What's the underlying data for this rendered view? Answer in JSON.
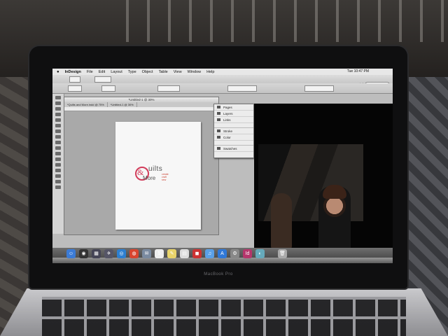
{
  "menubar": {
    "app_name": "InDesign",
    "items": [
      "File",
      "Edit",
      "Layout",
      "Type",
      "Object",
      "Table",
      "View",
      "Window",
      "Help"
    ],
    "clock": "Tue 10:47 PM",
    "battery": "100%"
  },
  "control_bar": {
    "workspace": "Essentials",
    "zoom": "30%"
  },
  "document": {
    "window_title": "*Untitled-1 @ 30%",
    "tabs": [
      "*Quilts and More.indd @ 75%",
      "*Untitled-1 @ 30%"
    ],
    "logo": {
      "amp": "&",
      "line1": "uilts",
      "line2": "More",
      "tagline": [
        "create",
        "craft",
        "sew"
      ]
    }
  },
  "panel": {
    "items": [
      "Pages",
      "Layers",
      "Links",
      "Stroke",
      "Color",
      "Swatches"
    ]
  },
  "dock": {
    "icons": [
      {
        "name": "finder-icon",
        "glyph": "☺",
        "color": "#3b7bd6"
      },
      {
        "name": "dashboard-icon",
        "glyph": "◉",
        "color": "#333"
      },
      {
        "name": "mission-control-icon",
        "glyph": "▦",
        "color": "#445"
      },
      {
        "name": "launchpad-icon",
        "glyph": "✈",
        "color": "#556"
      },
      {
        "name": "safari-icon",
        "glyph": "◎",
        "color": "#2d7fd0"
      },
      {
        "name": "chrome-icon",
        "glyph": "◍",
        "color": "#d8442f"
      },
      {
        "name": "mail-icon",
        "glyph": "✉",
        "color": "#7a8aa0"
      },
      {
        "name": "calendar-icon",
        "glyph": "5",
        "color": "#eee"
      },
      {
        "name": "notes-icon",
        "glyph": "✎",
        "color": "#e8d36a"
      },
      {
        "name": "stickies-icon",
        "glyph": "▤",
        "color": "#ddd"
      },
      {
        "name": "photo-booth-icon",
        "glyph": "◼",
        "color": "#c33"
      },
      {
        "name": "itunes-icon",
        "glyph": "♫",
        "color": "#5aa0e8"
      },
      {
        "name": "app-store-icon",
        "glyph": "A",
        "color": "#2f78d8"
      },
      {
        "name": "system-preferences-icon",
        "glyph": "⚙",
        "color": "#888"
      },
      {
        "name": "indesign-icon",
        "glyph": "Id",
        "color": "#b5366c"
      },
      {
        "name": "preview-icon",
        "glyph": "◐",
        "color": "#6ab"
      },
      {
        "name": "trash-icon",
        "glyph": "🗑",
        "color": "#aaa"
      }
    ]
  },
  "laptop": {
    "brand": "MacBook Pro"
  }
}
